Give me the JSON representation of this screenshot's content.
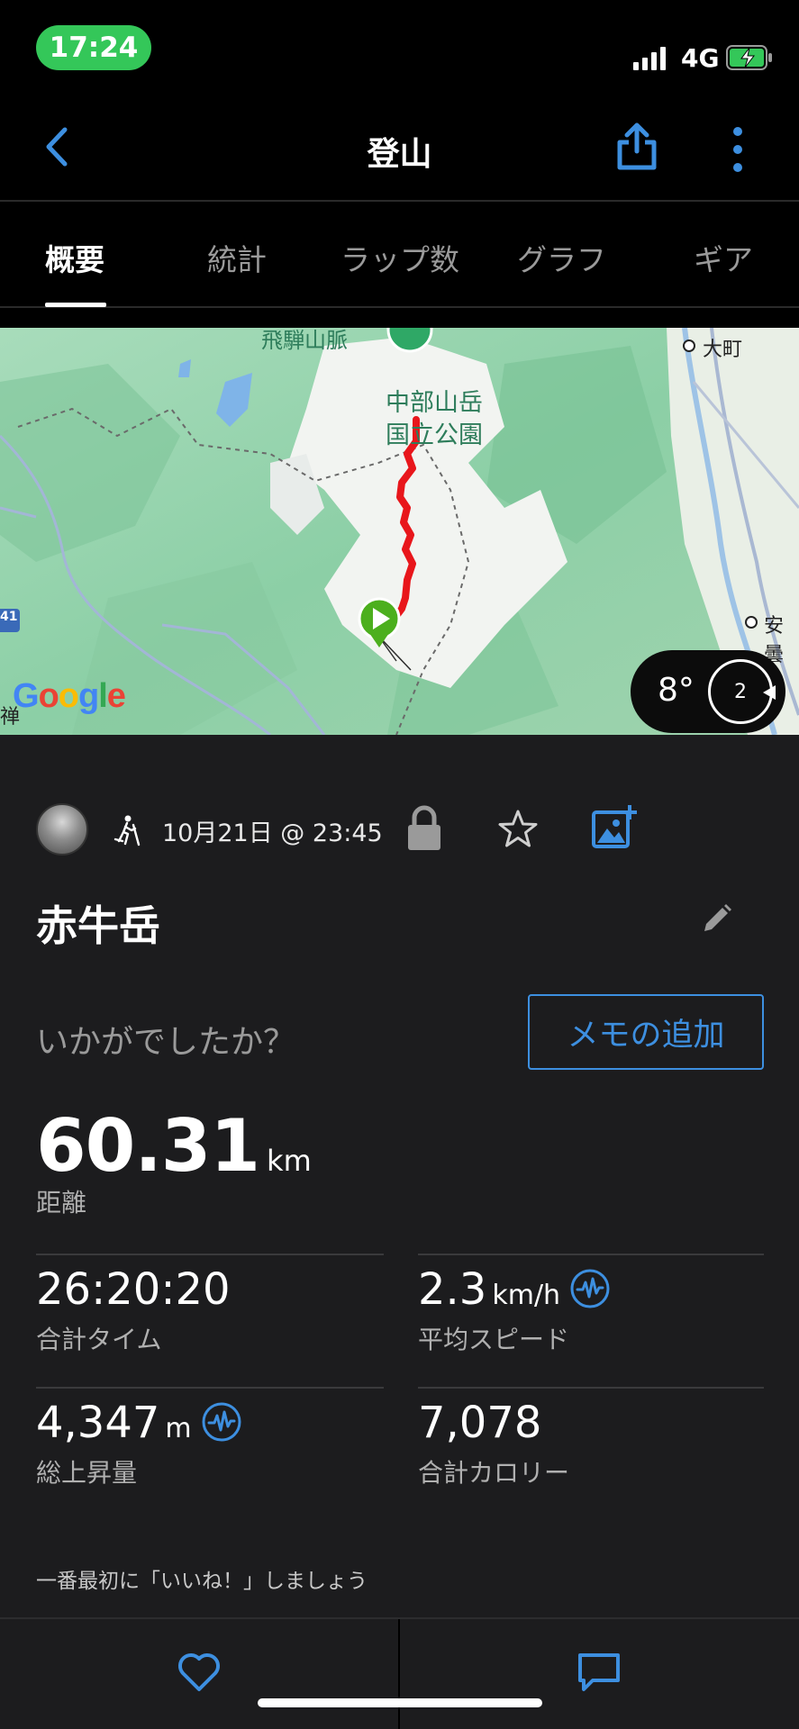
{
  "status_bar": {
    "time": "17:24",
    "network": "4G",
    "icons": [
      "signal-bars-icon",
      "battery-charging-icon"
    ]
  },
  "nav": {
    "title": "登山",
    "back_icon": "chevron-left-icon",
    "share_icon": "share-icon",
    "more_icon": "more-vertical-icon"
  },
  "tabs": [
    {
      "label": "概要",
      "active": true
    },
    {
      "label": "統計",
      "active": false
    },
    {
      "label": "ラップ数",
      "active": false
    },
    {
      "label": "グラフ",
      "active": false
    },
    {
      "label": "ギア",
      "active": false
    }
  ],
  "map": {
    "labels": {
      "top_partial": "飛騨山脈",
      "park": "中部山岳\n国立公園",
      "town_1": "大町",
      "town_2": "安曇",
      "road_marker": "41",
      "edge_char": "禅"
    },
    "logo": "Google",
    "weather": {
      "temperature": "8°",
      "wind_value": "2"
    }
  },
  "activity": {
    "date": "10月21日 @ 23:45",
    "title": "赤牛岳",
    "prompt": "いかがでしたか？",
    "memo_button": "メモの追加",
    "icons": [
      "avatar",
      "hiking-icon",
      "lock-icon",
      "star-icon",
      "add-photo-icon",
      "pencil-icon"
    ]
  },
  "stats": {
    "distance": {
      "value": "60.31",
      "unit": "km",
      "label": "距離"
    },
    "total_time": {
      "value": "26:20:20",
      "label": "合計タイム"
    },
    "avg_speed": {
      "value": "2.3",
      "unit": "km/h",
      "label": "平均スピード"
    },
    "ascent": {
      "value": "4,347",
      "unit": "m",
      "label": "総上昇量"
    },
    "calories": {
      "value": "7,078",
      "label": "合計カロリー"
    }
  },
  "like_prompt": "一番最初に「いいね！」しましょう",
  "bottom_bar": {
    "icons": [
      "heart-icon",
      "comment-icon"
    ]
  },
  "colors": {
    "accent": "#3d8fe0",
    "status_green": "#34c759",
    "route_red": "#e8161b",
    "start_green": "#4caf1e",
    "background": "#1c1c1e"
  }
}
